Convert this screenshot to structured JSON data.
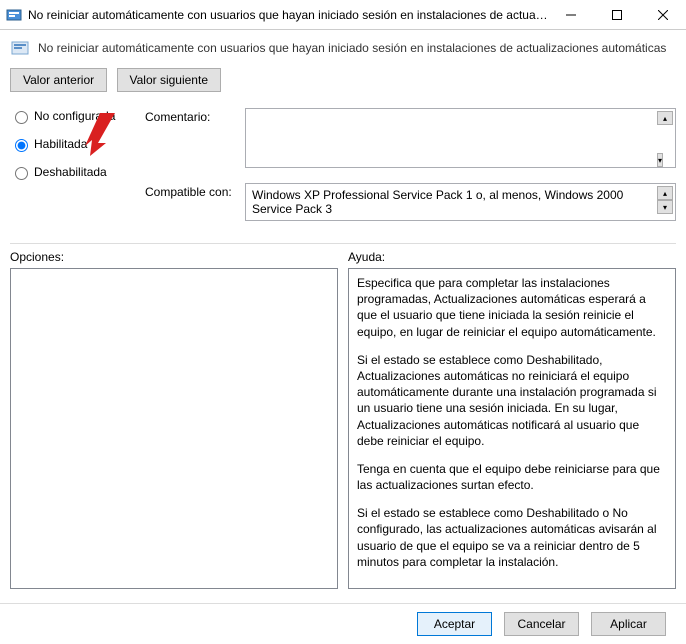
{
  "window": {
    "title": "No reiniciar automáticamente con usuarios que hayan iniciado sesión en instalaciones de actual..."
  },
  "header": {
    "fullTitle": "No reiniciar automáticamente con usuarios que hayan iniciado sesión en instalaciones de actualizaciones automáticas"
  },
  "nav": {
    "prev": "Valor anterior",
    "next": "Valor siguiente"
  },
  "radios": {
    "notConfigured": "No configurada",
    "enabled": "Habilitada",
    "disabled": "Deshabilitada",
    "selected": "enabled"
  },
  "fields": {
    "commentLabel": "Comentario:",
    "commentValue": "",
    "compatLabel": "Compatible con:",
    "compatValue": "Windows XP Professional Service Pack 1 o, al menos, Windows 2000 Service Pack 3"
  },
  "panels": {
    "optionsLabel": "Opciones:",
    "helpLabel": "Ayuda:"
  },
  "help": {
    "p1": "Especifica que para completar las instalaciones programadas, Actualizaciones automáticas esperará a que el usuario que tiene iniciada la sesión reinicie el equipo, en lugar de reiniciar el equipo automáticamente.",
    "p2": "Si el estado se establece como Deshabilitado, Actualizaciones automáticas no reiniciará el equipo automáticamente durante una instalación programada si un usuario tiene una sesión iniciada. En su lugar, Actualizaciones automáticas notificará al usuario que debe reiniciar el equipo.",
    "p3": "Tenga en cuenta que el equipo debe reiniciarse para que las actualizaciones surtan efecto.",
    "p4": "Si el estado se establece como Deshabilitado o No configurado, las actualizaciones automáticas avisarán al usuario de que el equipo se va a reiniciar dentro de 5 minutos para completar la instalación."
  },
  "footer": {
    "ok": "Aceptar",
    "cancel": "Cancelar",
    "apply": "Aplicar"
  }
}
